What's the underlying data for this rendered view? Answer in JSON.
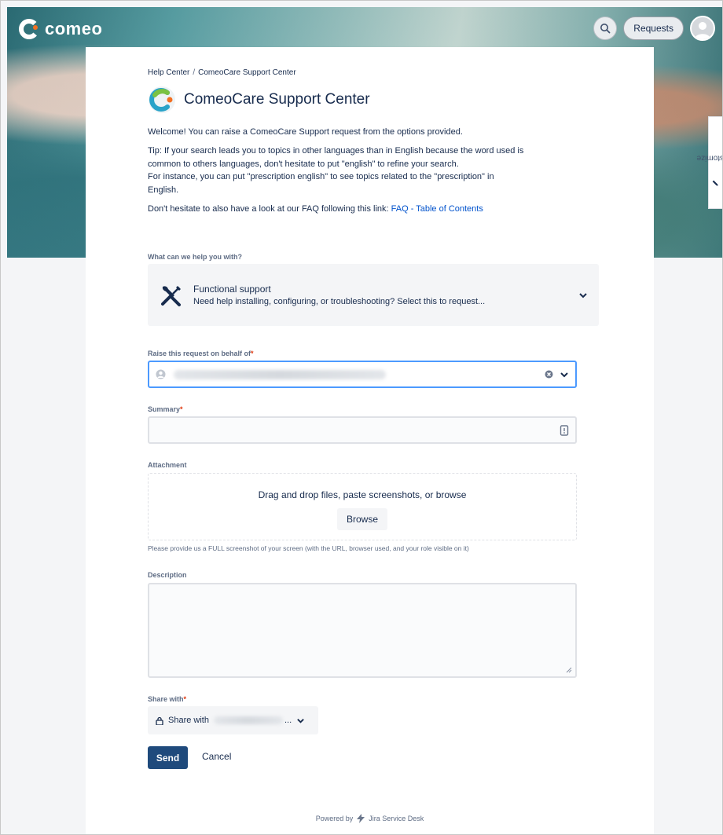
{
  "header": {
    "logo_text": "comeo",
    "requests_label": "Requests",
    "icons": [
      "search-icon",
      "user-avatar-icon"
    ]
  },
  "customize": {
    "label": "Customize",
    "icon": "pencil-icon"
  },
  "breadcrumb": {
    "home": "Help Center",
    "separator": "/",
    "current": "ComeoCare Support Center"
  },
  "page": {
    "title": "ComeoCare Support Center",
    "welcome": "Welcome! You can raise a ComeoCare Support request from the options provided.",
    "tip_lines": [
      "Tip: If your search leads you to topics in other languages than in English because the word used is",
      "common to others languages, don't hesitate to put \"english\" to refine your search.",
      "For instance, you can put \"prescription english\" to see topics related to the \"prescription\" in",
      "English."
    ],
    "faq_prefix": "Don't hesitate to also have a look at our FAQ following this link: ",
    "faq_link": "FAQ - Table of Contents"
  },
  "form": {
    "request_type_label": "What can we help you with?",
    "request_type": {
      "name": "Functional support",
      "description": "Need help installing, configuring, or troubleshooting? Select this to request...",
      "icon": "wrench-screwdriver-icon"
    },
    "on_behalf_label": "Raise this request on behalf of",
    "summary_label": "Summary",
    "attachment_label": "Attachment",
    "attachment_drop_text": "Drag and drop files, paste screenshots, or browse",
    "browse_label": "Browse",
    "attachment_help": "Please provide us a FULL screenshot of your screen (with the URL, browser used, and your role visible on it)",
    "description_label": "Description",
    "share_label": "Share with",
    "share_button_prefix": "Share with",
    "share_button_suffix": "...",
    "required_mark": "*",
    "send_label": "Send",
    "cancel_label": "Cancel"
  },
  "footer": {
    "powered_by": "Powered by",
    "product": "Jira Service Desk"
  },
  "colors": {
    "primary": "#1f4a7c",
    "link": "#0052cc",
    "required": "#de350b",
    "focus": "#4c9aff"
  }
}
